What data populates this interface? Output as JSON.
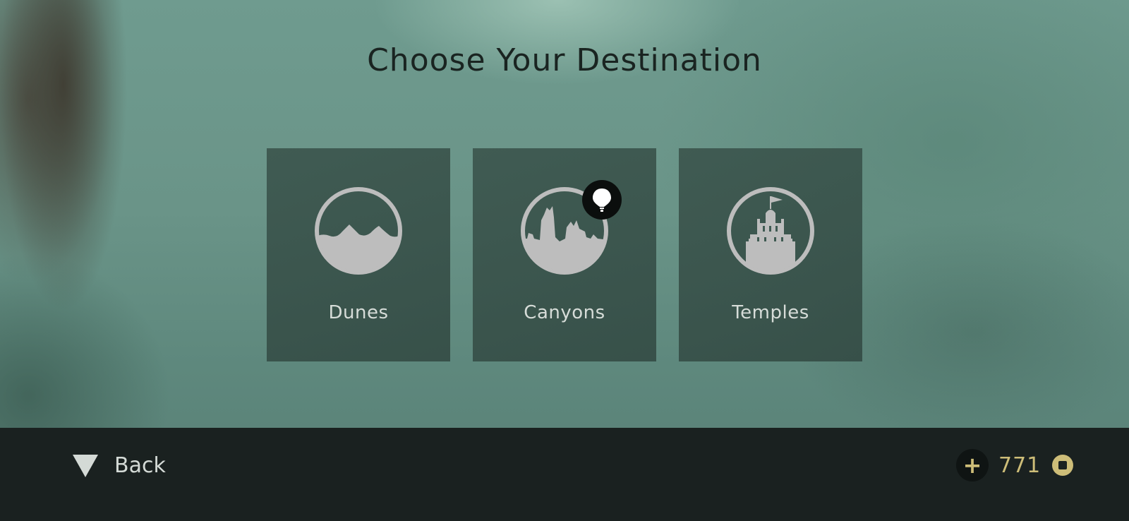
{
  "screen": {
    "title": "Choose Your Destination"
  },
  "destinations": [
    {
      "label": "Dunes",
      "icon": "dunes-icon"
    },
    {
      "label": "Canyons",
      "icon": "canyons-icon",
      "badge": "balloon-icon"
    },
    {
      "label": "Temples",
      "icon": "temples-icon"
    }
  ],
  "footer": {
    "back_label": "Back",
    "back_icon": "down-triangle-icon",
    "currency_amount": "771",
    "currency_icon": "coin-icon",
    "add_icon": "plus-icon"
  },
  "colors": {
    "icon_fill": "#bdbdbd",
    "currency": "#cdbd78",
    "footer_bg": "#1a2120"
  }
}
